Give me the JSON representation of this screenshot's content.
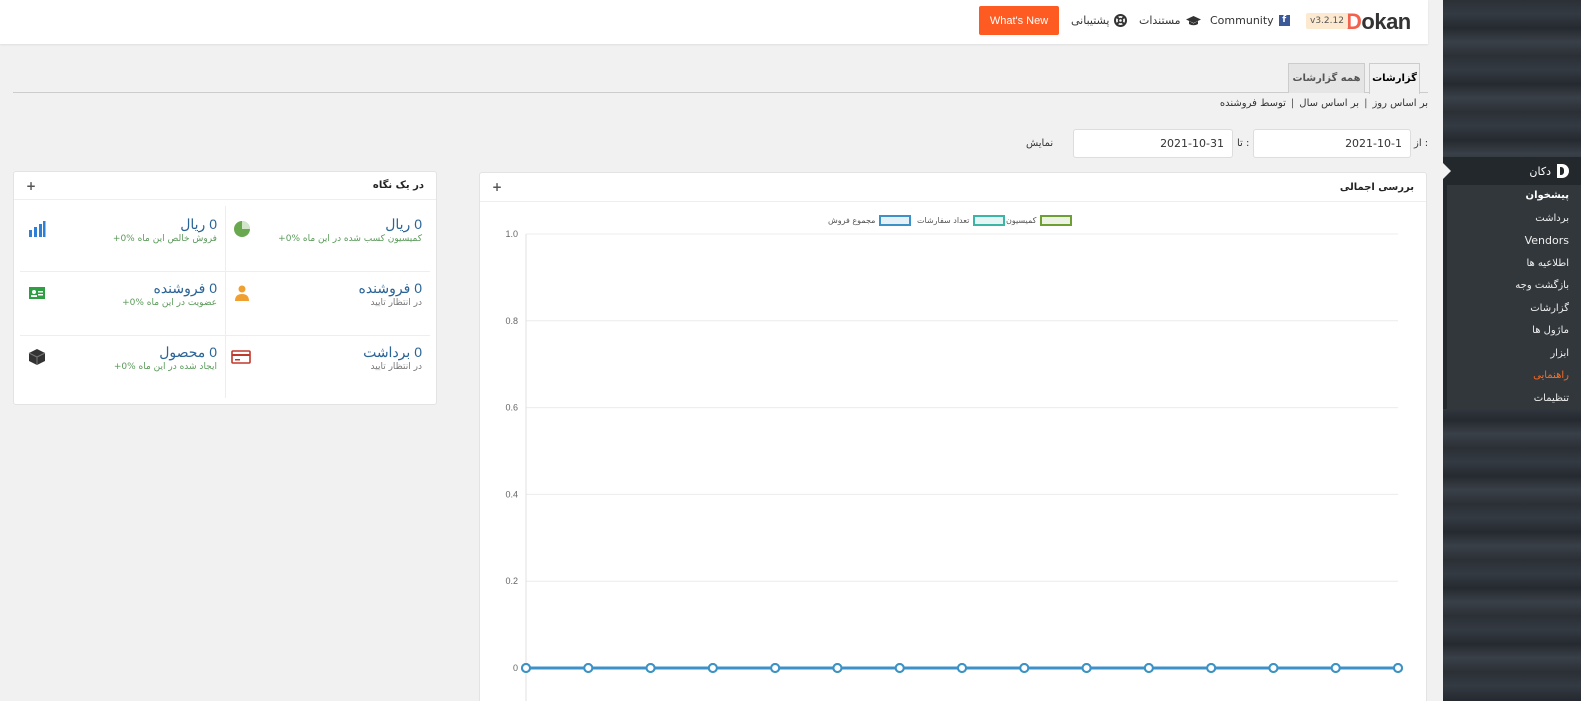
{
  "topbar": {
    "logo_prefix": "D",
    "logo_rest": "okan",
    "version": "v3.2.12",
    "community": "Community",
    "docs": "مستندات",
    "support": "پشتیبانی",
    "whats_new": "What's New"
  },
  "sidebar": {
    "title": "دکان",
    "items": [
      {
        "label": "پیشخوان",
        "style": "bold"
      },
      {
        "label": "برداشت",
        "style": ""
      },
      {
        "label": "Vendors",
        "style": "vend"
      },
      {
        "label": "اطلاعیه ها",
        "style": ""
      },
      {
        "label": "بازگشت وجه",
        "style": ""
      },
      {
        "label": "گزارشات",
        "style": ""
      },
      {
        "label": "ماژول ها",
        "style": ""
      },
      {
        "label": "ابزار",
        "style": ""
      },
      {
        "label": "راهنمایی",
        "style": "active"
      },
      {
        "label": "تنظیمات",
        "style": ""
      }
    ]
  },
  "tabs": [
    {
      "label": "گزارشات",
      "active": true
    },
    {
      "label": "همه گزارشات",
      "active": false
    }
  ],
  "subnav": [
    "بر اساس روز",
    "بر اساس سال",
    "توسط فروشنده"
  ],
  "filter": {
    "from_label": "از :",
    "from_value": "2021-10-1",
    "to_label": "تا :",
    "to_value": "2021-10-31",
    "show_label": "نمایش"
  },
  "glance": {
    "title": "در یک نگاه",
    "toggle": "+",
    "cells": [
      {
        "value": "0 ریال",
        "sub": "فروش خالص این ماه ‎+0%",
        "icon": "bar-chart-icon",
        "subcolor": "green"
      },
      {
        "value": "0 ریال",
        "sub": "کمیسیون کسب شده در این ماه ‎+0%",
        "icon": "pie-chart-icon",
        "subcolor": "green"
      },
      {
        "value": "0 فروشنده",
        "sub": "عضویت در این ماه ‎+0%",
        "icon": "id-card-icon",
        "subcolor": "green"
      },
      {
        "value": "0 فروشنده",
        "sub": "در انتظار تایید",
        "icon": "user-icon",
        "subcolor": "gray"
      },
      {
        "value": "0 محصول",
        "sub": "ایجاد شده در این ماه ‎+0%",
        "icon": "box-icon",
        "subcolor": "green"
      },
      {
        "value": "0 برداشت",
        "sub": "در انتظار تایید",
        "icon": "credit-card-icon",
        "subcolor": "gray"
      }
    ]
  },
  "overview": {
    "title": "بررسی اجمالی",
    "toggle": "+"
  },
  "chart_data": {
    "type": "line",
    "title": "",
    "xlabel": "",
    "ylabel": "",
    "ylim": [
      0,
      1.0
    ],
    "y_ticks": [
      "0",
      "0.2",
      "0.4",
      "0.6",
      "0.8",
      "1.0"
    ],
    "legend_placement": "top",
    "series": [
      {
        "name": "کمیسیون",
        "color": "#6d9f32",
        "values": [
          0,
          0,
          0,
          0,
          0,
          0,
          0,
          0,
          0,
          0,
          0,
          0,
          0,
          0,
          0
        ]
      },
      {
        "name": "تعداد سفارشات",
        "color": "#3bb5a5",
        "values": [
          0,
          0,
          0,
          0,
          0,
          0,
          0,
          0,
          0,
          0,
          0,
          0,
          0,
          0,
          0
        ]
      },
      {
        "name": "مجموع فروش",
        "color": "#3c92c8",
        "values": [
          0,
          0,
          0,
          0,
          0,
          0,
          0,
          0,
          0,
          0,
          0,
          0,
          0,
          0,
          0
        ]
      }
    ],
    "grid": true
  }
}
